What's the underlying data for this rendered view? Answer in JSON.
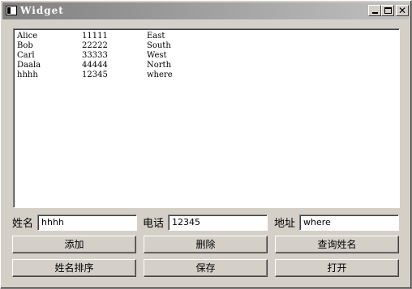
{
  "window": {
    "title": "Widget"
  },
  "list": {
    "rows": [
      {
        "name": "Alice",
        "phone": "11111",
        "address": "East"
      },
      {
        "name": "Bob",
        "phone": "22222",
        "address": "South"
      },
      {
        "name": "Carl",
        "phone": "33333",
        "address": "West"
      },
      {
        "name": "Daala",
        "phone": "44444",
        "address": "North"
      },
      {
        "name": "hhhh",
        "phone": "12345",
        "address": "where"
      }
    ]
  },
  "form": {
    "name_label": "姓名",
    "name_value": "hhhh",
    "phone_label": "电话",
    "phone_value": "12345",
    "address_label": "地址",
    "address_value": "where"
  },
  "buttons": {
    "add": "添加",
    "delete": "删除",
    "search": "查询姓名",
    "sort": "姓名排序",
    "save": "保存",
    "open": "打开"
  },
  "icons": [
    "app-icon",
    "minimize-icon",
    "maximize-icon",
    "close-icon"
  ]
}
